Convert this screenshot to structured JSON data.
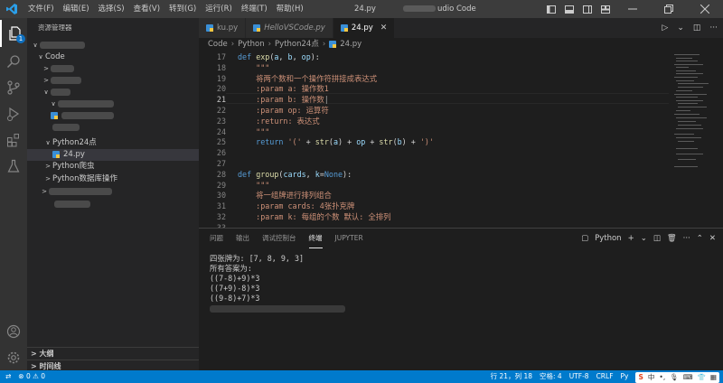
{
  "titlebar": {
    "menu": [
      "文件(F)",
      "编辑(E)",
      "选择(S)",
      "查看(V)",
      "转到(G)",
      "运行(R)",
      "终端(T)",
      "帮助(H)"
    ],
    "title_file": "24.py",
    "title_app": "udio Code"
  },
  "sidebar": {
    "header": "资源管理器",
    "items": [
      {
        "label": "Code",
        "chev": "∨"
      },
      {
        "label": "Python24点",
        "chev": "∨"
      },
      {
        "label": "24.py"
      },
      {
        "label": "Python爬虫",
        "chev": ">"
      },
      {
        "label": "Python数据库操作",
        "chev": ">"
      }
    ],
    "outline_label": "大纲",
    "timeline_label": "时间线"
  },
  "tabs": [
    {
      "label": "ku.py",
      "italic": false
    },
    {
      "label": "HelloVSCode.py",
      "italic": true
    },
    {
      "label": "24.py",
      "italic": false,
      "active": true
    }
  ],
  "breadcrumb": [
    "Code",
    "Python",
    "Python24点",
    "24.py"
  ],
  "code": {
    "line_numbers": [
      "17",
      "18",
      "19",
      "20",
      "21",
      "22",
      "23",
      "24",
      "25",
      "26",
      "27",
      "28",
      "29",
      "30",
      "31",
      "32",
      "33"
    ],
    "current_line": "21"
  },
  "panel": {
    "tabs": [
      "问题",
      "输出",
      "调试控制台",
      "终端",
      "JUPYTER"
    ],
    "active_tab": "终端",
    "terminal_kind": "Python",
    "output": [
      "四张牌为: [7, 8, 9, 3]",
      "所有答案为:",
      "((7-8)+9)*3",
      "((7+9)-8)*3",
      "((9-8)+7)*3"
    ]
  },
  "statusbar": {
    "errors": "0",
    "warnings": "0",
    "position": "行 21，列 18",
    "spaces": "空格: 4",
    "encoding": "UTF-8",
    "eol": "CRLF",
    "language": "Py"
  },
  "colors": {
    "accent": "#007acc",
    "keyword": "#569cd6",
    "function": "#dcdcaa",
    "string": "#ce9178",
    "param": "#9cdcfe"
  }
}
